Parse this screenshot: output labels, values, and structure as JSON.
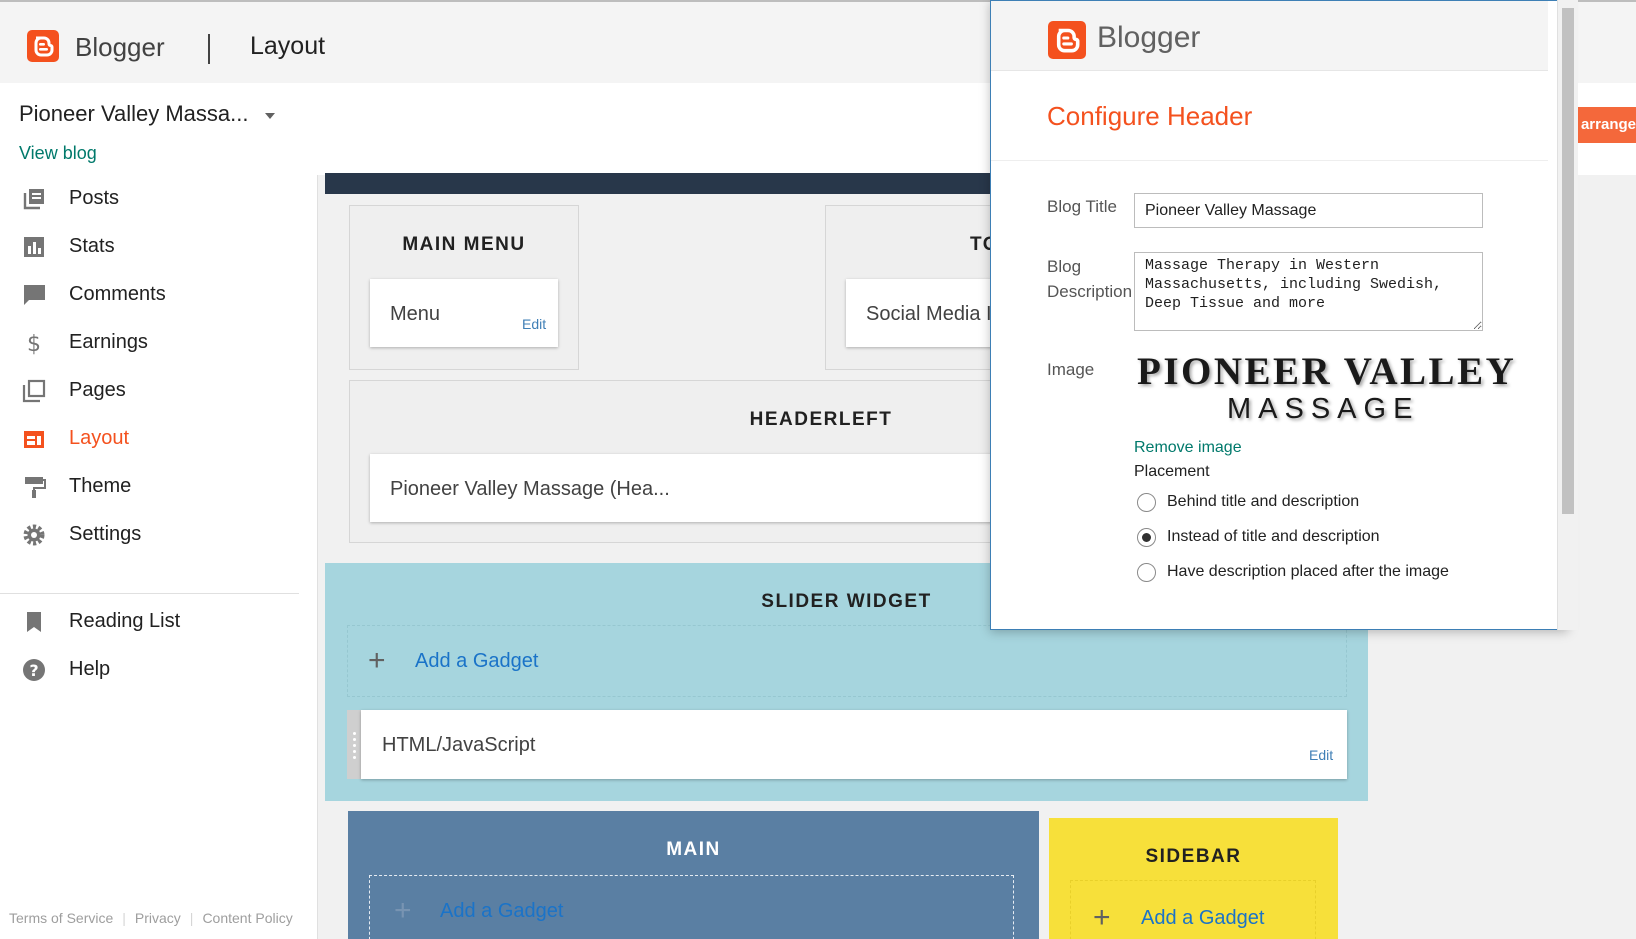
{
  "app": {
    "brand": "Blogger",
    "page_title": "Layout"
  },
  "blog": {
    "name": "Pioneer Valley Massa...",
    "view_blog": "View blog"
  },
  "nav": {
    "items": [
      {
        "label": "Posts",
        "icon": "posts-icon",
        "active": false
      },
      {
        "label": "Stats",
        "icon": "stats-icon",
        "active": false
      },
      {
        "label": "Comments",
        "icon": "comments-icon",
        "active": false
      },
      {
        "label": "Earnings",
        "icon": "dollar-icon",
        "active": false
      },
      {
        "label": "Pages",
        "icon": "pages-icon",
        "active": false
      },
      {
        "label": "Layout",
        "icon": "layout-icon",
        "active": true
      },
      {
        "label": "Theme",
        "icon": "paint-roller-icon",
        "active": false
      },
      {
        "label": "Settings",
        "icon": "gear-icon",
        "active": false
      }
    ],
    "secondary": [
      {
        "label": "Reading List",
        "icon": "bookmark-icon"
      },
      {
        "label": "Help",
        "icon": "help-icon"
      }
    ],
    "footer": {
      "terms": "Terms of Service",
      "privacy": "Privacy",
      "content_policy": "Content Policy"
    }
  },
  "layout": {
    "main_menu": {
      "title": "MAIN MENU",
      "gadget": "Menu",
      "edit": "Edit"
    },
    "top_section": {
      "title_partial": "TO",
      "gadget_partial": "Social Media I"
    },
    "headerleft": {
      "title": "HEADERLEFT",
      "gadget": "Pioneer Valley Massage (Hea..."
    },
    "slider": {
      "title": "SLIDER WIDGET",
      "add_gadget": "Add a Gadget",
      "gadget": "HTML/JavaScript",
      "edit": "Edit"
    },
    "main": {
      "title": "MAIN",
      "add_gadget": "Add a Gadget"
    },
    "sidebar": {
      "title": "SIDEBAR",
      "add_gadget": "Add a Gadget"
    },
    "save_arrangement_partial": "ve arrange"
  },
  "popup": {
    "brand": "Blogger",
    "title": "Configure Header",
    "blog_title_label": "Blog Title",
    "blog_title_value": "Pioneer Valley Massage",
    "description_label_1": "Blog",
    "description_label_2": "Description",
    "description_value": "Massage Therapy in Western Massachusetts, including Swedish, Deep Tissue and more",
    "image_label": "Image",
    "image_text_line1": "PIONEER VALLEY",
    "image_text_line2": "MASSAGE",
    "remove_image": "Remove image",
    "placement_label": "Placement",
    "placement_options": [
      {
        "label": "Behind title and description",
        "checked": false
      },
      {
        "label": "Instead of title and description",
        "checked": true
      },
      {
        "label": "Have description placed after the image",
        "checked": false
      }
    ]
  },
  "colors": {
    "accent": "#f4511e",
    "link": "#00796b",
    "gadget_link": "#1a73c8",
    "slider_bg": "#a6d5de",
    "main_bg": "#5a7fa3",
    "sidebar_bg": "#f7e03a",
    "strip": "#28374a"
  }
}
